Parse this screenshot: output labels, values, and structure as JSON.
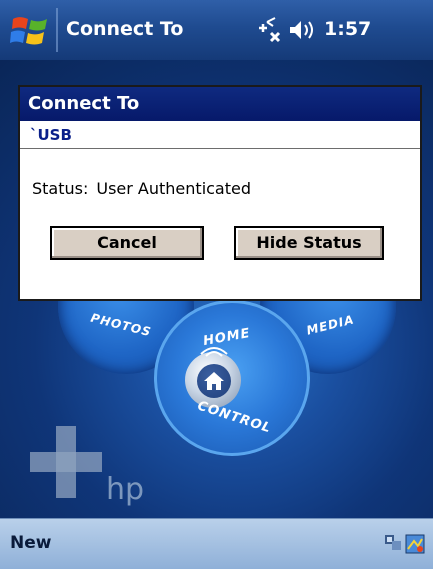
{
  "titlebar": {
    "title": "Connect To",
    "time": "1:57",
    "icons": [
      "windows-start-icon",
      "connectivity-icon",
      "volume-icon"
    ]
  },
  "today": {
    "buttons": {
      "photos": "PHOTOS",
      "media": "MEDIA",
      "home_top": "HOME",
      "home_bottom": "CONTROL"
    },
    "brand": "hp"
  },
  "dialog": {
    "title": "Connect To",
    "connection_name": "`USB",
    "status_label": "Status:",
    "status_value": "User Authenticated",
    "cancel_label": "Cancel",
    "hide_status_label": "Hide Status"
  },
  "menubar": {
    "left_softkey": "New",
    "tray_icons": [
      "connection-tray-icon",
      "app-tray-icon"
    ]
  },
  "colors": {
    "titlebar": "#1f4b90",
    "dialog_title": "#0f2a80",
    "button_face": "#d9cfc4",
    "today_background": "#0f3578"
  }
}
